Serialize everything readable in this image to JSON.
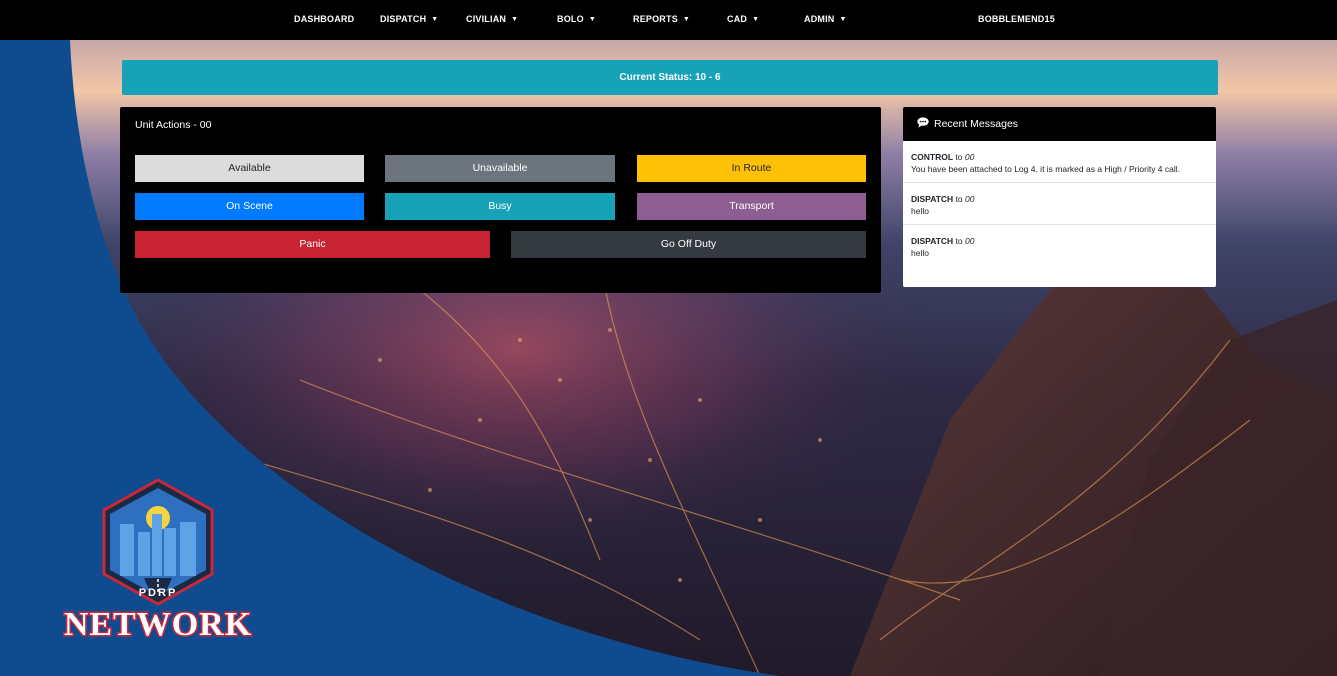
{
  "nav": {
    "items": [
      {
        "label": "DASHBOARD",
        "caret": false
      },
      {
        "label": "DISPATCH",
        "caret": true
      },
      {
        "label": "CIVILIAN",
        "caret": true
      },
      {
        "label": "BOLO",
        "caret": true
      },
      {
        "label": "REPORTS",
        "caret": true
      },
      {
        "label": "CAD",
        "caret": true
      },
      {
        "label": "ADMIN",
        "caret": true
      }
    ],
    "user": "BOBBLEMEND15",
    "caret_glyph": "▼"
  },
  "status": {
    "text": "Current Status: 10 - 6"
  },
  "unit_actions": {
    "title": "Unit Actions - 00",
    "buttons": {
      "available": "Available",
      "unavailable": "Unavailable",
      "in_route": "In Route",
      "on_scene": "On Scene",
      "busy": "Busy",
      "transport": "Transport",
      "panic": "Panic",
      "off_duty": "Go Off Duty"
    }
  },
  "messages": {
    "title": "Recent Messages",
    "items": [
      {
        "sender": "CONTROL",
        "to": "to",
        "target": "00",
        "text": "You have been attached to Log 4. it is marked as a High / Priority 4 call."
      },
      {
        "sender": "DISPATCH",
        "to": "to",
        "target": "00",
        "text": "hello"
      },
      {
        "sender": "DISPATCH",
        "to": "to",
        "target": "00",
        "text": "hello"
      }
    ]
  },
  "logo": {
    "line1": "PDRP",
    "line2": "NETWORK"
  },
  "colors": {
    "available": "#dcdcdc",
    "unavailable": "#6c757d",
    "in_route": "#ffc107",
    "on_scene": "#007bff",
    "busy": "#17a2b8",
    "transport": "#8e5d92",
    "panic": "#c82333",
    "off_duty": "#343a40",
    "background_blue": "#0f4c8f"
  }
}
